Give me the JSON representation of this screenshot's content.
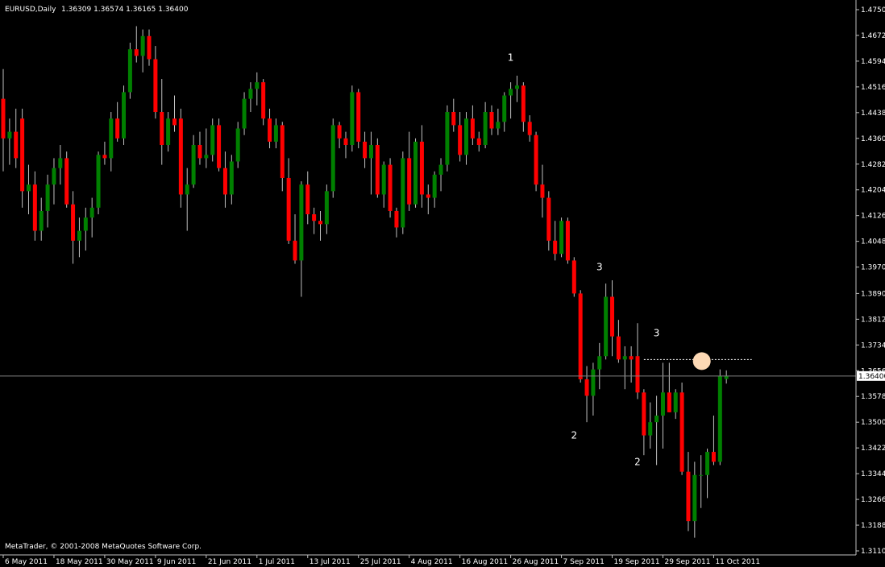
{
  "header": {
    "title": "EURUSD,Daily",
    "ohlc": "1.36309 1.36574 1.36165 1.36400"
  },
  "footer": {
    "copyright": "MetaTrader, © 2001-2008 MetaQuotes Software Corp."
  },
  "colors": {
    "background": "#000000",
    "bull": "#008000",
    "bear": "#ff0000",
    "axis": "#c0c0c0",
    "bid_line": "#808080",
    "marker": "#fdd9b5"
  },
  "chart_data": {
    "type": "candlestick",
    "symbol": "EURUSD",
    "timeframe": "Daily",
    "ylim": [
      1.311,
      1.475
    ],
    "y_ticks": [
      "1.47500",
      "1.46720",
      "1.45940",
      "1.45160",
      "1.44380",
      "1.43600",
      "1.42820",
      "1.42040",
      "1.41260",
      "1.40480",
      "1.39700",
      "1.38900",
      "1.38120",
      "1.37340",
      "1.36560",
      "1.35780",
      "1.35000",
      "1.34220",
      "1.33440",
      "1.32660",
      "1.31880",
      "1.31100"
    ],
    "current_price": "1.36400",
    "x_ticks": [
      {
        "label": "6 May 2011",
        "i": 0
      },
      {
        "label": "18 May 2011",
        "i": 8
      },
      {
        "label": "30 May 2011",
        "i": 16
      },
      {
        "label": "9 Jun 2011",
        "i": 24
      },
      {
        "label": "21 Jun 2011",
        "i": 32
      },
      {
        "label": "1 Jul 2011",
        "i": 40
      },
      {
        "label": "13 Jul 2011",
        "i": 48
      },
      {
        "label": "25 Jul 2011",
        "i": 56
      },
      {
        "label": "4 Aug 2011",
        "i": 64
      },
      {
        "label": "16 Aug 2011",
        "i": 72
      },
      {
        "label": "26 Aug 2011",
        "i": 80
      },
      {
        "label": "7 Sep 2011",
        "i": 88
      },
      {
        "label": "19 Sep 2011",
        "i": 96
      },
      {
        "label": "29 Sep 2011",
        "i": 104
      },
      {
        "label": "11 Oct 2011",
        "i": 112
      }
    ],
    "candles": [
      [
        1.448,
        1.457,
        1.426,
        1.436
      ],
      [
        1.436,
        1.442,
        1.428,
        1.438
      ],
      [
        1.438,
        1.445,
        1.427,
        1.43
      ],
      [
        1.442,
        1.445,
        1.415,
        1.42
      ],
      [
        1.42,
        1.428,
        1.413,
        1.422
      ],
      [
        1.422,
        1.426,
        1.405,
        1.408
      ],
      [
        1.408,
        1.418,
        1.405,
        1.414
      ],
      [
        1.414,
        1.425,
        1.409,
        1.422
      ],
      [
        1.422,
        1.43,
        1.416,
        1.427
      ],
      [
        1.427,
        1.434,
        1.422,
        1.43
      ],
      [
        1.43,
        1.432,
        1.415,
        1.416
      ],
      [
        1.416,
        1.42,
        1.398,
        1.405
      ],
      [
        1.405,
        1.412,
        1.4,
        1.408
      ],
      [
        1.408,
        1.415,
        1.402,
        1.412
      ],
      [
        1.412,
        1.418,
        1.406,
        1.415
      ],
      [
        1.415,
        1.432,
        1.413,
        1.431
      ],
      [
        1.431,
        1.435,
        1.428,
        1.43
      ],
      [
        1.43,
        1.444,
        1.426,
        1.442
      ],
      [
        1.442,
        1.447,
        1.435,
        1.436
      ],
      [
        1.436,
        1.452,
        1.434,
        1.45
      ],
      [
        1.45,
        1.465,
        1.448,
        1.463
      ],
      [
        1.463,
        1.47,
        1.459,
        1.461
      ],
      [
        1.461,
        1.469,
        1.456,
        1.467
      ],
      [
        1.467,
        1.469,
        1.458,
        1.46
      ],
      [
        1.46,
        1.464,
        1.442,
        1.444
      ],
      [
        1.444,
        1.454,
        1.428,
        1.434
      ],
      [
        1.434,
        1.444,
        1.432,
        1.442
      ],
      [
        1.442,
        1.449,
        1.438,
        1.44
      ],
      [
        1.442,
        1.445,
        1.415,
        1.419
      ],
      [
        1.419,
        1.427,
        1.408,
        1.422
      ],
      [
        1.422,
        1.437,
        1.421,
        1.434
      ],
      [
        1.434,
        1.438,
        1.428,
        1.43
      ],
      [
        1.43,
        1.439,
        1.427,
        1.431
      ],
      [
        1.431,
        1.442,
        1.429,
        1.44
      ],
      [
        1.44,
        1.442,
        1.426,
        1.427
      ],
      [
        1.427,
        1.432,
        1.415,
        1.419
      ],
      [
        1.419,
        1.431,
        1.416,
        1.429
      ],
      [
        1.429,
        1.441,
        1.427,
        1.439
      ],
      [
        1.439,
        1.45,
        1.437,
        1.448
      ],
      [
        1.448,
        1.453,
        1.444,
        1.451
      ],
      [
        1.451,
        1.456,
        1.446,
        1.453
      ],
      [
        1.453,
        1.454,
        1.44,
        1.442
      ],
      [
        1.442,
        1.445,
        1.433,
        1.435
      ],
      [
        1.435,
        1.442,
        1.433,
        1.44
      ],
      [
        1.44,
        1.441,
        1.42,
        1.424
      ],
      [
        1.424,
        1.43,
        1.404,
        1.405
      ],
      [
        1.405,
        1.413,
        1.398,
        1.399
      ],
      [
        1.399,
        1.423,
        1.388,
        1.422
      ],
      [
        1.422,
        1.426,
        1.41,
        1.413
      ],
      [
        1.413,
        1.415,
        1.407,
        1.411
      ],
      [
        1.411,
        1.414,
        1.405,
        1.41
      ],
      [
        1.41,
        1.422,
        1.407,
        1.42
      ],
      [
        1.42,
        1.442,
        1.418,
        1.44
      ],
      [
        1.44,
        1.441,
        1.433,
        1.436
      ],
      [
        1.436,
        1.438,
        1.43,
        1.434
      ],
      [
        1.434,
        1.452,
        1.432,
        1.45
      ],
      [
        1.45,
        1.451,
        1.433,
        1.435
      ],
      [
        1.435,
        1.438,
        1.427,
        1.43
      ],
      [
        1.43,
        1.438,
        1.419,
        1.434
      ],
      [
        1.434,
        1.436,
        1.418,
        1.419
      ],
      [
        1.419,
        1.429,
        1.415,
        1.428
      ],
      [
        1.428,
        1.43,
        1.412,
        1.414
      ],
      [
        1.414,
        1.415,
        1.406,
        1.409
      ],
      [
        1.409,
        1.432,
        1.407,
        1.43
      ],
      [
        1.43,
        1.438,
        1.414,
        1.416
      ],
      [
        1.416,
        1.436,
        1.415,
        1.435
      ],
      [
        1.435,
        1.44,
        1.415,
        1.419
      ],
      [
        1.419,
        1.422,
        1.413,
        1.418
      ],
      [
        1.418,
        1.426,
        1.415,
        1.425
      ],
      [
        1.425,
        1.43,
        1.42,
        1.428
      ],
      [
        1.428,
        1.446,
        1.426,
        1.444
      ],
      [
        1.444,
        1.448,
        1.438,
        1.44
      ],
      [
        1.44,
        1.444,
        1.429,
        1.431
      ],
      [
        1.431,
        1.444,
        1.428,
        1.442
      ],
      [
        1.442,
        1.446,
        1.434,
        1.436
      ],
      [
        1.436,
        1.438,
        1.432,
        1.434
      ],
      [
        1.434,
        1.447,
        1.433,
        1.444
      ],
      [
        1.444,
        1.446,
        1.437,
        1.439
      ],
      [
        1.439,
        1.445,
        1.437,
        1.441
      ],
      [
        1.441,
        1.45,
        1.438,
        1.449
      ],
      [
        1.449,
        1.453,
        1.442,
        1.451
      ],
      [
        1.451,
        1.455,
        1.447,
        1.452
      ],
      [
        1.452,
        1.453,
        1.438,
        1.441
      ],
      [
        1.441,
        1.443,
        1.435,
        1.437
      ],
      [
        1.437,
        1.438,
        1.42,
        1.422
      ],
      [
        1.422,
        1.428,
        1.412,
        1.418
      ],
      [
        1.418,
        1.42,
        1.402,
        1.405
      ],
      [
        1.405,
        1.411,
        1.399,
        1.401
      ],
      [
        1.401,
        1.412,
        1.4,
        1.411
      ],
      [
        1.411,
        1.412,
        1.398,
        1.399
      ],
      [
        1.399,
        1.4,
        1.388,
        1.389
      ],
      [
        1.389,
        1.39,
        1.362,
        1.363
      ],
      [
        1.363,
        1.367,
        1.35,
        1.358
      ],
      [
        1.358,
        1.368,
        1.352,
        1.366
      ],
      [
        1.366,
        1.374,
        1.36,
        1.37
      ],
      [
        1.37,
        1.392,
        1.369,
        1.388
      ],
      [
        1.388,
        1.393,
        1.37,
        1.376
      ],
      [
        1.376,
        1.381,
        1.368,
        1.369
      ],
      [
        1.369,
        1.373,
        1.36,
        1.37
      ],
      [
        1.37,
        1.373,
        1.362,
        1.369
      ],
      [
        1.37,
        1.38,
        1.357,
        1.359
      ],
      [
        1.359,
        1.36,
        1.34,
        1.346
      ],
      [
        1.346,
        1.356,
        1.342,
        1.35
      ],
      [
        1.35,
        1.358,
        1.337,
        1.352
      ],
      [
        1.352,
        1.368,
        1.342,
        1.359
      ],
      [
        1.359,
        1.368,
        1.353,
        1.353
      ],
      [
        1.353,
        1.36,
        1.351,
        1.359
      ],
      [
        1.359,
        1.362,
        1.334,
        1.335
      ],
      [
        1.335,
        1.341,
        1.317,
        1.32
      ],
      [
        1.32,
        1.338,
        1.315,
        1.334
      ],
      [
        1.334,
        1.34,
        1.324,
        1.334
      ],
      [
        1.334,
        1.342,
        1.327,
        1.341
      ],
      [
        1.341,
        1.352,
        1.337,
        1.338
      ],
      [
        1.338,
        1.366,
        1.337,
        1.364
      ],
      [
        1.3631,
        1.3657,
        1.3617,
        1.364
      ]
    ],
    "annotations": [
      {
        "text": "1",
        "i": 80,
        "price": 1.4595
      },
      {
        "text": "3",
        "i": 94,
        "price": 1.396
      },
      {
        "text": "2",
        "i": 90,
        "price": 1.345
      },
      {
        "text": "3",
        "i": 103,
        "price": 1.376
      },
      {
        "text": "2",
        "i": 100,
        "price": 1.337
      }
    ],
    "marker": {
      "i": 110,
      "price": 1.3685
    },
    "dotted_level": {
      "price": 1.369,
      "from_i": 101,
      "to_i": 118
    }
  }
}
